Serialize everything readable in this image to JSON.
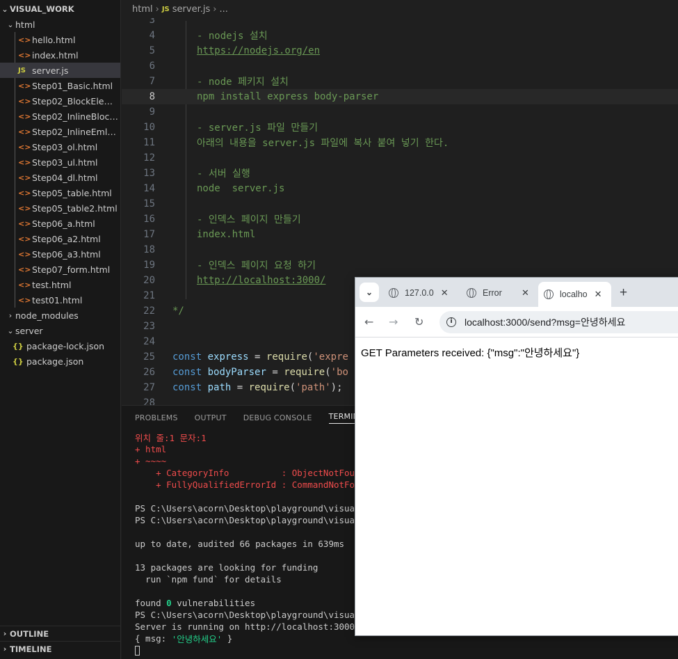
{
  "explorer": {
    "root_label": "VISUAL_WORK",
    "items": [
      {
        "label": "html",
        "type": "folder",
        "open": true
      },
      {
        "label": "hello.html",
        "type": "html"
      },
      {
        "label": "index.html",
        "type": "html"
      },
      {
        "label": "server.js",
        "type": "js",
        "selected": true
      },
      {
        "label": "Step01_Basic.html",
        "type": "html"
      },
      {
        "label": "Step02_BlockElemen...",
        "type": "html"
      },
      {
        "label": "Step02_InlineBlock.h...",
        "type": "html"
      },
      {
        "label": "Step02_InlineEmlem...",
        "type": "html"
      },
      {
        "label": "Step03_ol.html",
        "type": "html"
      },
      {
        "label": "Step03_ul.html",
        "type": "html"
      },
      {
        "label": "Step04_dl.html",
        "type": "html"
      },
      {
        "label": "Step05_table.html",
        "type": "html"
      },
      {
        "label": "Step05_table2.html",
        "type": "html"
      },
      {
        "label": "Step06_a.html",
        "type": "html"
      },
      {
        "label": "Step06_a2.html",
        "type": "html"
      },
      {
        "label": "Step06_a3.html",
        "type": "html"
      },
      {
        "label": "Step07_form.html",
        "type": "html"
      },
      {
        "label": "test.html",
        "type": "html"
      },
      {
        "label": "test01.html",
        "type": "html"
      },
      {
        "label": "node_modules",
        "type": "folder",
        "open": false
      },
      {
        "label": "server",
        "type": "folder",
        "open": true
      },
      {
        "label": "package-lock.json",
        "type": "json"
      },
      {
        "label": "package.json",
        "type": "json"
      }
    ],
    "outline_label": "OUTLINE",
    "timeline_label": "TIMELINE"
  },
  "breadcrumb": {
    "folder": "html",
    "js_badge": "JS",
    "file": "server.js",
    "more": "..."
  },
  "editor": {
    "lines": [
      {
        "n": "3",
        "t": ""
      },
      {
        "n": "4",
        "t": "- nodejs 설치"
      },
      {
        "n": "5",
        "t": "https://nodejs.org/en"
      },
      {
        "n": "6",
        "t": ""
      },
      {
        "n": "7",
        "t": "- node 페키지 설치"
      },
      {
        "n": "8",
        "t": "npm install express body-parser"
      },
      {
        "n": "9",
        "t": ""
      },
      {
        "n": "10",
        "t": "- server.js 파일 만들기"
      },
      {
        "n": "11",
        "t": "아래의 내용을 server.js 파일에 복사 붙여 넣기 한다."
      },
      {
        "n": "12",
        "t": ""
      },
      {
        "n": "13",
        "t": "- 서버 실행"
      },
      {
        "n": "14",
        "t": "node  server.js"
      },
      {
        "n": "15",
        "t": ""
      },
      {
        "n": "16",
        "t": "- 인덱스 페이지 만들기"
      },
      {
        "n": "17",
        "t": "index.html"
      },
      {
        "n": "18",
        "t": ""
      },
      {
        "n": "19",
        "t": "- 인덱스 페이지 요청 하기"
      },
      {
        "n": "20",
        "t": "http://localhost:3000/"
      },
      {
        "n": "21",
        "t": ""
      },
      {
        "n": "22",
        "t": "*/"
      },
      {
        "n": "23",
        "t": ""
      },
      {
        "n": "24",
        "t": ""
      },
      {
        "n": "25",
        "t": ""
      },
      {
        "n": "26",
        "t": ""
      },
      {
        "n": "27",
        "t": ""
      },
      {
        "n": "28",
        "t": ""
      }
    ],
    "code25": {
      "kw": "const",
      "var": "express",
      "eq": " = ",
      "fn": "require",
      "p": "(",
      "s": "'expre"
    },
    "code26": {
      "kw": "const",
      "var": "bodyParser",
      "eq": " = ",
      "fn": "require",
      "p": "(",
      "s": "'bo"
    },
    "code27": {
      "kw": "const",
      "var": "path",
      "eq": " = ",
      "fn": "require",
      "p": "(",
      "s": "'path'",
      "end": ");"
    }
  },
  "panel": {
    "tabs": [
      "PROBLEMS",
      "OUTPUT",
      "DEBUG CONSOLE",
      "TERMINAL"
    ],
    "active_tab": "TERMINAL",
    "terminal": [
      {
        "t": "위치 줄:1 문자:1",
        "c": "red"
      },
      {
        "t": "+ html",
        "c": "red"
      },
      {
        "t": "+ ~~~~",
        "c": "red"
      },
      {
        "t": "    + CategoryInfo          : ObjectNotFound:",
        "c": "red"
      },
      {
        "t": "    + FullyQualifiedErrorId : CommandNotFound",
        "c": "red"
      },
      {
        "t": "",
        "c": "white"
      },
      {
        "t": "PS C:\\Users\\acorn\\Desktop\\playground\\visual_w",
        "c": "white"
      },
      {
        "t": "PS C:\\Users\\acorn\\Desktop\\playground\\visual_w",
        "c": "white"
      },
      {
        "t": "",
        "c": "white"
      },
      {
        "t": "up to date, audited 66 packages in 639ms",
        "c": "white"
      },
      {
        "t": "",
        "c": "white"
      },
      {
        "t": "13 packages are looking for funding",
        "c": "white"
      },
      {
        "t": "  run `npm fund` for details",
        "c": "white"
      },
      {
        "t": "",
        "c": "white"
      },
      {
        "t": "found 0 vulnerabilities",
        "c": "white"
      },
      {
        "t": "PS C:\\Users\\acorn\\Desktop\\playground\\visual_w",
        "c": "white"
      },
      {
        "t": "Server is running on http://localhost:3000",
        "c": "white"
      }
    ],
    "found_prefix": "found ",
    "found_count": "0",
    "found_suffix": " vulnerabilities",
    "msg_line": {
      "open": "{ msg: ",
      "value": "'안녕하세요'",
      "close": " }"
    }
  },
  "browser": {
    "tabs": [
      {
        "title": "127.0.0",
        "active": false
      },
      {
        "title": "Error",
        "active": false
      },
      {
        "title": "localho",
        "active": true
      }
    ],
    "new_tab": "+",
    "url": "localhost:3000/send?msg=안녕하세요",
    "content": "GET Parameters received: {\"msg\":\"안녕하세요\"}"
  }
}
